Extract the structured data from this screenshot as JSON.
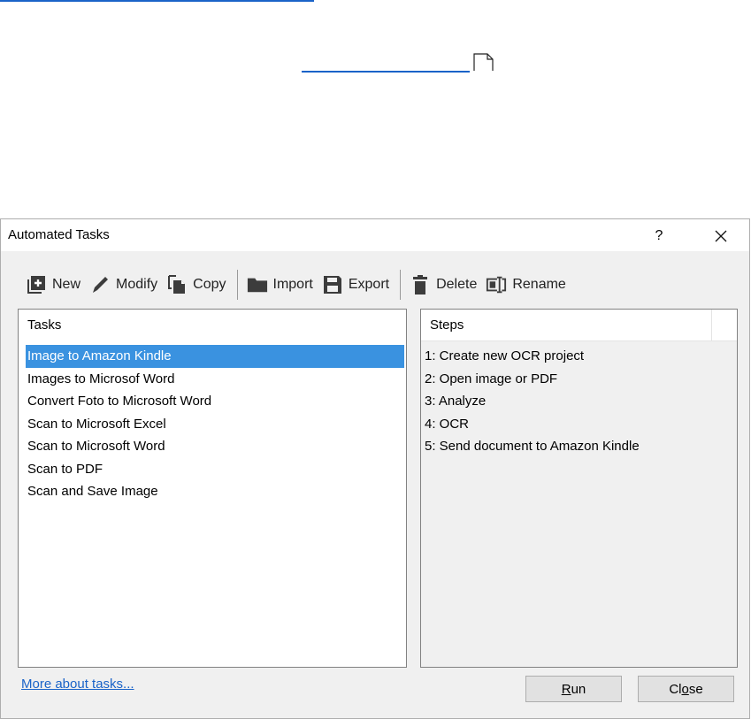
{
  "dialog": {
    "title": "Automated Tasks",
    "help_label": "?"
  },
  "toolbar": {
    "items": [
      {
        "label": "New",
        "icon": "add-icon"
      },
      {
        "label": "Modify",
        "icon": "pencil-icon"
      },
      {
        "label": "Copy",
        "icon": "copy-icon"
      },
      {
        "label": "Import",
        "icon": "folder-icon"
      },
      {
        "label": "Export",
        "icon": "save-icon"
      },
      {
        "label": "Delete",
        "icon": "trash-icon"
      },
      {
        "label": "Rename",
        "icon": "rename-icon"
      }
    ]
  },
  "tasks": {
    "header": "Tasks",
    "items": [
      "Image to Amazon Kindle",
      "Images to Microsof Word",
      "Convert Foto to Microsoft Word",
      "Scan to Microsoft Excel",
      "Scan to Microsoft Word",
      "Scan to PDF",
      "Scan and Save Image"
    ],
    "selected_index": 0
  },
  "steps": {
    "header": "Steps",
    "items": [
      "1: Create new OCR project",
      "2: Open image or PDF",
      "3: Analyze",
      "4: OCR",
      "5: Send document to Amazon Kindle"
    ]
  },
  "footer": {
    "more_link": "More about tasks...",
    "run_pre": "",
    "run_key": "R",
    "run_post": "un",
    "close_pre": "Cl",
    "close_key": "o",
    "close_post": "se"
  },
  "colors": {
    "selection": "#3a92e0",
    "link": "#1a63c8",
    "icon": "#3c3c3c"
  }
}
